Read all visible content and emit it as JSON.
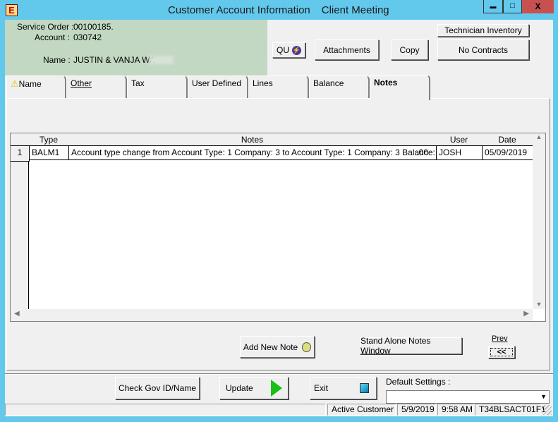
{
  "window": {
    "title": "Customer Account Information",
    "subtitle": "Client Meeting",
    "app_icon_letter": "E",
    "minimize": "▬",
    "maximize": "□",
    "close": "X"
  },
  "header": {
    "service_order_label": "Service Order :",
    "service_order": "00100185.",
    "account_label": "Account :",
    "account": "030742",
    "name_label": "Name :",
    "name": "JUSTIN & VANJA WA"
  },
  "buttons": {
    "qu": "QU",
    "attachments": "Attachments",
    "copy": "Copy",
    "technician_inventory": "Technician Inventory",
    "no_contracts": "No Contracts",
    "add_new_note": "Add New Note",
    "stand_alone": "Stand Alone Notes Window",
    "prev_label": "Prev",
    "prev": "<<",
    "check_gov": "Check Gov ID/Name",
    "update": "Update",
    "exit": "Exit"
  },
  "tabs": [
    {
      "label": "Name"
    },
    {
      "label": "Other"
    },
    {
      "label": "Tax"
    },
    {
      "label": "User Defined"
    },
    {
      "label": "Lines"
    },
    {
      "label": "Balance"
    },
    {
      "label": "Notes",
      "active": true
    }
  ],
  "grid": {
    "columns": [
      "Type",
      "Notes",
      "User",
      "Date"
    ],
    "rows": [
      {
        "num": "1",
        "type": "BALM1",
        "notes": "Account type change from Account Type: 1 Company: 3 to Account Type: 1 Company: 3 Balance:",
        "amount": ".00",
        "user": "JOSH",
        "date": "05/09/2019"
      }
    ]
  },
  "default_settings": {
    "label": "Default Settings :",
    "value": ""
  },
  "status": {
    "customer": "Active Customer",
    "date": "5/9/2019",
    "time": "9:58 AM",
    "terminal": "T34BLSACT01F1"
  },
  "colors": {
    "titlebar": "#62c8ec",
    "header_panel": "#c2d8c2",
    "close": "#c75050"
  }
}
